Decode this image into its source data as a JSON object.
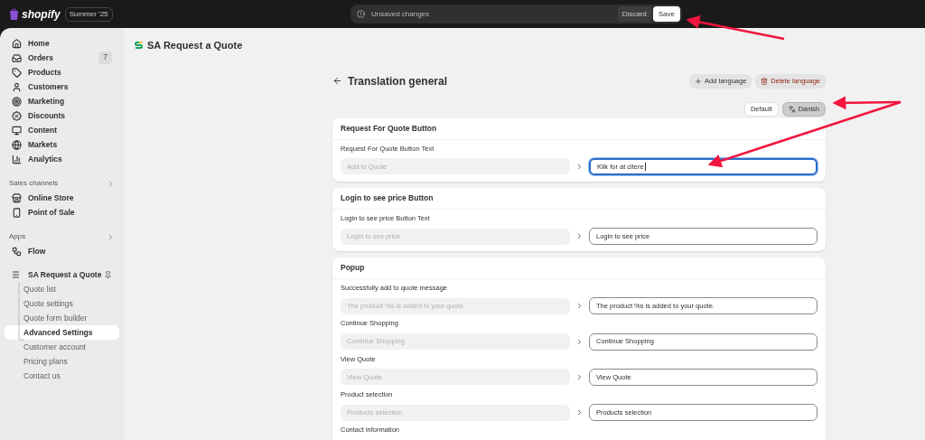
{
  "topbar": {
    "brand": "shopify",
    "edition": "Summer '25",
    "unsaved": {
      "message": "Unsaved changes",
      "discard": "Discard",
      "save": "Save"
    }
  },
  "sidebar": {
    "items": [
      {
        "label": "Home",
        "selected": false
      },
      {
        "label": "Orders",
        "badge": "7",
        "selected": false
      },
      {
        "label": "Products",
        "selected": false
      },
      {
        "label": "Customers",
        "selected": false
      },
      {
        "label": "Marketing",
        "selected": false
      },
      {
        "label": "Discounts",
        "selected": false
      },
      {
        "label": "Content",
        "selected": false
      },
      {
        "label": "Markets",
        "selected": false
      },
      {
        "label": "Analytics",
        "selected": false
      }
    ],
    "sales_channels": {
      "title": "Sales channels",
      "items": [
        {
          "label": "Online Store"
        },
        {
          "label": "Point of Sale"
        }
      ]
    },
    "apps": {
      "title": "Apps",
      "items": [
        {
          "label": "Flow"
        }
      ]
    },
    "app": {
      "label": "SA Request a Quote",
      "children": [
        {
          "label": "Quote list",
          "selected": false
        },
        {
          "label": "Quote settings",
          "selected": false
        },
        {
          "label": "Quote form builder",
          "selected": false
        },
        {
          "label": "Advanced Settings",
          "selected": true
        },
        {
          "label": "Customer account",
          "selected": false
        },
        {
          "label": "Pricing plans",
          "selected": false
        },
        {
          "label": "Contact us",
          "selected": false
        }
      ]
    }
  },
  "app_title": "SA Request a Quote",
  "page": {
    "title": "Translation general",
    "add_language": "Add language",
    "delete_language": "Delete language",
    "languages": [
      {
        "label": "Default",
        "selected": false
      },
      {
        "label": "Danish",
        "selected": true
      }
    ],
    "cards": [
      {
        "title": "Request For Quote Button",
        "fields": [
          {
            "label": "Request For Quote Button Text",
            "source": "Add to Quote",
            "value": "Klik for at citere",
            "focused": true
          }
        ]
      },
      {
        "title": "Login to see price Button",
        "fields": [
          {
            "label": "Login to see price Button Text",
            "source": "Login to see price",
            "value": "Login to see price",
            "focused": false
          }
        ]
      },
      {
        "title": "Popup",
        "fields": [
          {
            "label": "Successfully add to quote message",
            "source": "The product %s is added to your quote.",
            "value": "The product %s is added to your quote.",
            "focused": false
          },
          {
            "label": "Continue Shopping",
            "source": "Continue Shopping",
            "value": "Continue Shopping",
            "focused": false
          },
          {
            "label": "View Quote",
            "source": "View Quote",
            "value": "View Quote",
            "focused": false
          },
          {
            "label": "Product selection",
            "source": "Products selection",
            "value": "Products selection",
            "focused": false
          },
          {
            "label": "Contact information"
          }
        ]
      }
    ]
  }
}
